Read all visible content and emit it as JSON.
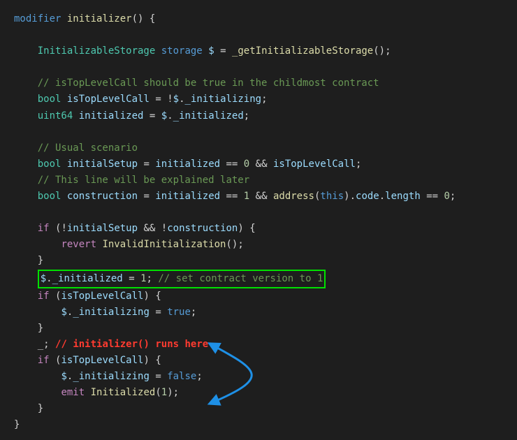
{
  "code": {
    "line1": {
      "kw": "modifier",
      "fn": "initializer",
      "paren": "()",
      "brace": "{"
    },
    "line3": {
      "type": "InitializableStorage",
      "kw": "storage",
      "var": "$",
      "eq": "=",
      "fn": "_getInitializableStorage",
      "paren": "();"
    },
    "line5": {
      "comment": "// isTopLevelCall should be true in the childmost contract"
    },
    "line6": {
      "type": "bool",
      "var": "isTopLevelCall",
      "eq": "=",
      "bang": "!",
      "obj": "$",
      "dot": ".",
      "field": "_initializing",
      "semi": ";"
    },
    "line7": {
      "type": "uint64",
      "var": "initialized",
      "eq": "=",
      "obj": "$",
      "dot": ".",
      "field": "_initialized",
      "semi": ";"
    },
    "line9": {
      "comment": "// Usual scenario"
    },
    "line10": {
      "type": "bool",
      "var": "initialSetup",
      "eq": "=",
      "rhs1": "initialized",
      "op1": "==",
      "num": "0",
      "op2": "&&",
      "rhs2": "isTopLevelCall",
      "semi": ";"
    },
    "line11": {
      "comment": "// This line will be explained later"
    },
    "line12": {
      "type": "bool",
      "var": "construction",
      "eq": "=",
      "rhs1": "initialized",
      "op1": "==",
      "num": "1",
      "op2": "&&",
      "fn": "address",
      "lp": "(",
      "kw": "this",
      "rp": ")",
      "dot1": ".",
      "m1": "code",
      "dot2": ".",
      "m2": "length",
      "op3": "==",
      "num2": "0",
      "semi": ";"
    },
    "line14": {
      "kw": "if",
      "lp": "(",
      "bang": "!",
      "v1": "initialSetup",
      "op": "&&",
      "bang2": "!",
      "v2": "construction",
      "rp": ")",
      "brace": "{"
    },
    "line15": {
      "kw": "revert",
      "fn": "InvalidInitialization",
      "paren": "();"
    },
    "line16": {
      "brace": "}"
    },
    "line17": {
      "obj": "$",
      "dot": ".",
      "field": "_initialized",
      "eq": "=",
      "num": "1",
      "semi": ";",
      "comment": "// set contract version to 1"
    },
    "line18": {
      "kw": "if",
      "lp": "(",
      "v": "isTopLevelCall",
      "rp": ")",
      "brace": "{"
    },
    "line19": {
      "obj": "$",
      "dot": ".",
      "field": "_initializing",
      "eq": "=",
      "bool": "true",
      "semi": ";"
    },
    "line20": {
      "brace": "}"
    },
    "line21": {
      "placeholder": "_",
      "semi": ";",
      "comment_pre": "// ",
      "fn": "initializer()",
      "comment_post": " runs here"
    },
    "line22": {
      "kw": "if",
      "lp": "(",
      "v": "isTopLevelCall",
      "rp": ")",
      "brace": "{"
    },
    "line23": {
      "obj": "$",
      "dot": ".",
      "field": "_initializing",
      "eq": "=",
      "bool": "false",
      "semi": ";"
    },
    "line24": {
      "kw": "emit",
      "fn": "Initialized",
      "lp": "(",
      "num": "1",
      "rp": ");"
    },
    "line25": {
      "brace": "}"
    },
    "line26": {
      "brace": "}"
    }
  },
  "annotations": {
    "arrow_color": "#1e90e6"
  }
}
